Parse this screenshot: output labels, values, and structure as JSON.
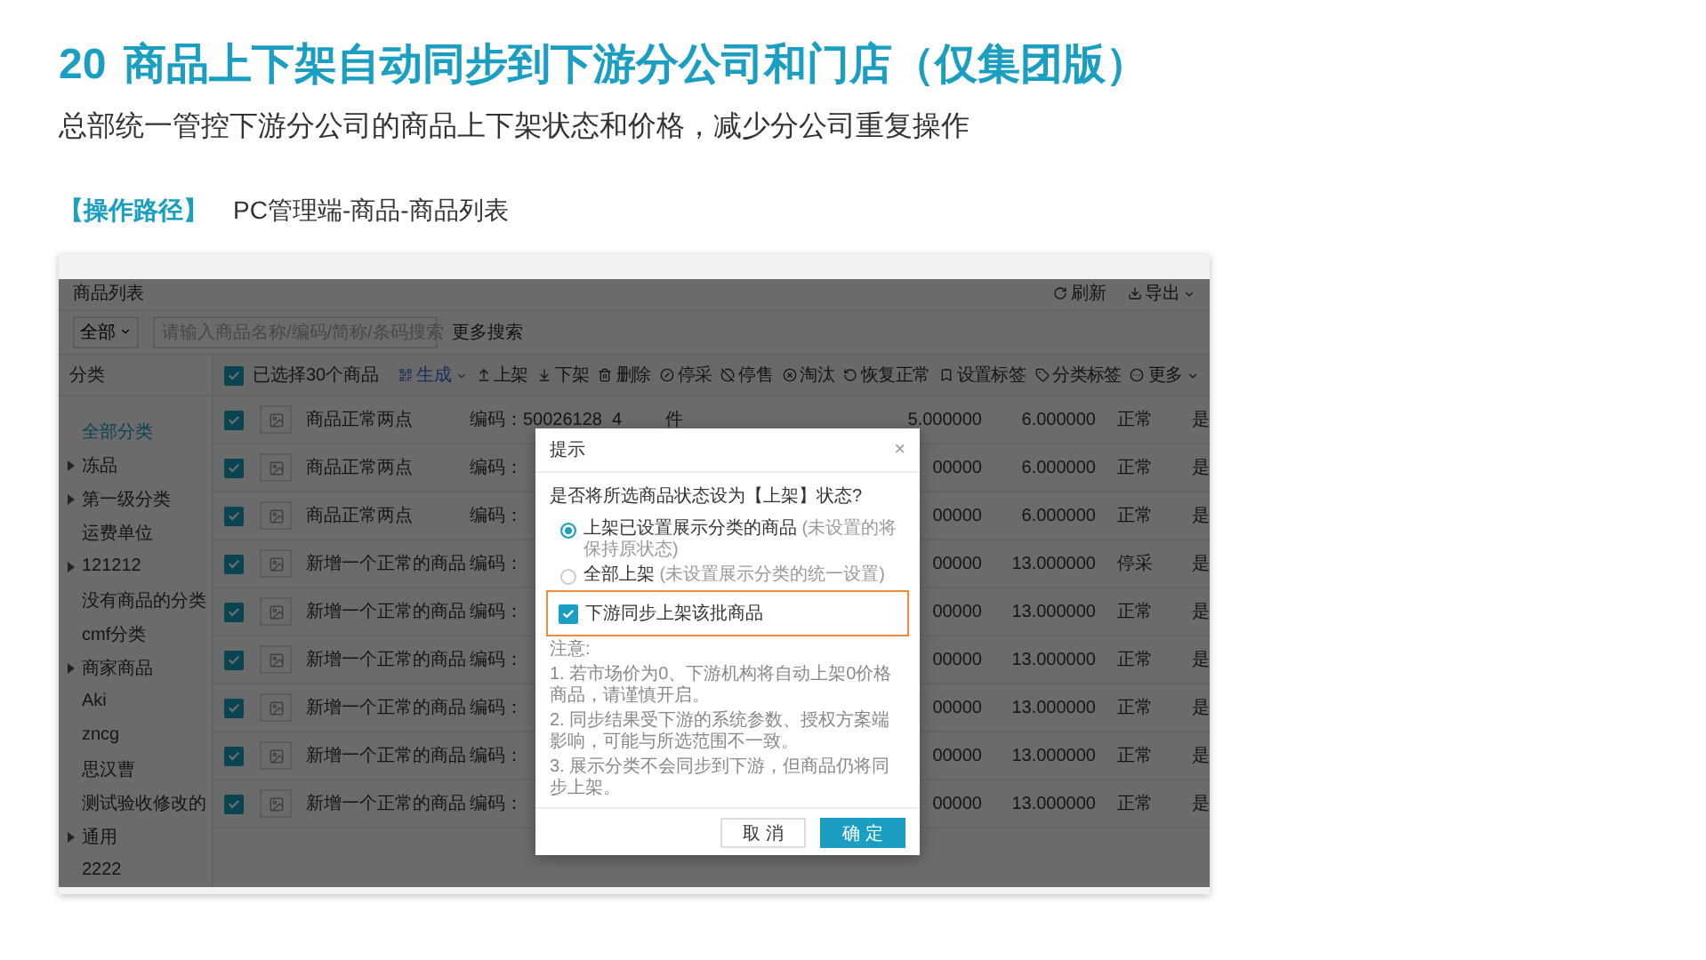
{
  "slide": {
    "number": "20",
    "title": "商品上下架自动同步到下游分公司和门店（仅集团版）",
    "subtitle": "总部统一管控下游分公司的商品上下架状态和价格，减少分公司重复操作",
    "path_label": "【操作路径】",
    "path": "PC管理端-商品-商品列表"
  },
  "app": {
    "page_title": "商品列表",
    "header_actions": [
      {
        "label": "刷新",
        "dropdown": false
      },
      {
        "label": "导出",
        "dropdown": true
      }
    ],
    "search": {
      "scope": "全部",
      "placeholder": "请输入商品名称/编码/简称/条码搜索",
      "more": "更多搜索"
    },
    "sidebar": {
      "title": "分类",
      "items": [
        {
          "label": "全部分类",
          "selected": true,
          "kind": "leaf"
        },
        {
          "label": "冻品",
          "selected": false,
          "kind": "group"
        },
        {
          "label": "第一级分类",
          "selected": false,
          "kind": "group"
        },
        {
          "label": "运费单位",
          "selected": false,
          "kind": "leaf"
        },
        {
          "label": "121212",
          "selected": false,
          "kind": "group"
        },
        {
          "label": "没有商品的分类",
          "selected": false,
          "kind": "leaf"
        },
        {
          "label": "cmf分类",
          "selected": false,
          "kind": "leaf"
        },
        {
          "label": "商家商品",
          "selected": false,
          "kind": "group"
        },
        {
          "label": "Aki",
          "selected": false,
          "kind": "leaf"
        },
        {
          "label": "zncg",
          "selected": false,
          "kind": "leaf"
        },
        {
          "label": "思汉曹",
          "selected": false,
          "kind": "leaf"
        },
        {
          "label": "测试验收修改的",
          "selected": false,
          "kind": "leaf"
        },
        {
          "label": "通用",
          "selected": false,
          "kind": "group"
        },
        {
          "label": "2222",
          "selected": false,
          "kind": "leaf"
        }
      ]
    },
    "toolbar": {
      "select_all": true,
      "selected_count": "已选择30个商品",
      "actions": [
        {
          "label": "生成",
          "dropdown": true,
          "highlighted": true
        },
        {
          "label": "上架",
          "dropdown": false,
          "highlighted": false
        },
        {
          "label": "下架",
          "dropdown": false,
          "highlighted": false
        },
        {
          "label": "删除",
          "dropdown": false,
          "highlighted": false
        },
        {
          "label": "停采",
          "dropdown": false,
          "highlighted": false
        },
        {
          "label": "停售",
          "dropdown": false,
          "highlighted": false
        },
        {
          "label": "淘汰",
          "dropdown": false,
          "highlighted": false
        },
        {
          "label": "恢复正常",
          "dropdown": false,
          "highlighted": false
        },
        {
          "label": "设置标签",
          "dropdown": false,
          "highlighted": false
        },
        {
          "label": "分类标签",
          "dropdown": false,
          "highlighted": false
        },
        {
          "label": "更多",
          "dropdown": true,
          "highlighted": false
        }
      ]
    },
    "rows": [
      {
        "checked": true,
        "name": "商品正常两点",
        "code": "编码：50026128",
        "qty": "4",
        "unit": "件",
        "price_1": "5.000000",
        "price_2": "6.000000",
        "status": "正常",
        "flag": "是"
      },
      {
        "checked": true,
        "name": "商品正常两点",
        "code": "编码：",
        "price_1": "00000",
        "price_2": "6.000000",
        "status": "正常",
        "flag": "是"
      },
      {
        "checked": true,
        "name": "商品正常两点",
        "code": "编码：",
        "price_1": "00000",
        "price_2": "6.000000",
        "status": "正常",
        "flag": "是"
      },
      {
        "checked": true,
        "name": "新增一个正常的商品",
        "code": "编码：",
        "price_1": "00000",
        "price_2": "13.000000",
        "status": "停采",
        "flag": "是"
      },
      {
        "checked": true,
        "name": "新增一个正常的商品",
        "code": "编码：",
        "price_1": "00000",
        "price_2": "13.000000",
        "status": "正常",
        "flag": "是"
      },
      {
        "checked": true,
        "name": "新增一个正常的商品",
        "code": "编码：",
        "price_1": "00000",
        "price_2": "13.000000",
        "status": "正常",
        "flag": "是"
      },
      {
        "checked": true,
        "name": "新增一个正常的商品",
        "code": "编码：",
        "price_1": "00000",
        "price_2": "13.000000",
        "status": "正常",
        "flag": "是"
      },
      {
        "checked": true,
        "name": "新增一个正常的商品",
        "code": "编码：",
        "price_1": "00000",
        "price_2": "13.000000",
        "status": "正常",
        "flag": "是"
      },
      {
        "checked": true,
        "name": "新增一个正常的商品",
        "code": "编码：",
        "price_1": "00000",
        "price_2": "13.000000",
        "status": "正常",
        "flag": "是"
      }
    ],
    "dialog": {
      "title": "提示",
      "close": "×",
      "question": "是否将所选商品状态设为【上架】状态?",
      "options": [
        {
          "label": "上架已设置展示分类的商品",
          "hint": "(未设置的将保持原状态)",
          "selected": true
        },
        {
          "label": "全部上架",
          "hint": "(未设置展示分类的统一设置)",
          "selected": false
        }
      ],
      "sync": {
        "label": "下游同步上架该批商品",
        "checked": true,
        "highlighted": true
      },
      "notes_title": "注意:",
      "notes": [
        "1. 若市场价为0、下游机构将自动上架0价格商品，请谨慎开启。",
        "2. 同步结果受下游的系统参数、授权方案端影响，可能与所选范围不一致。",
        "3. 展示分类不会同步到下游，但商品仍将同步上架。"
      ],
      "buttons": [
        {
          "label": "取 消",
          "kind": "secondary"
        },
        {
          "label": "确 定",
          "kind": "primary"
        }
      ]
    }
  }
}
